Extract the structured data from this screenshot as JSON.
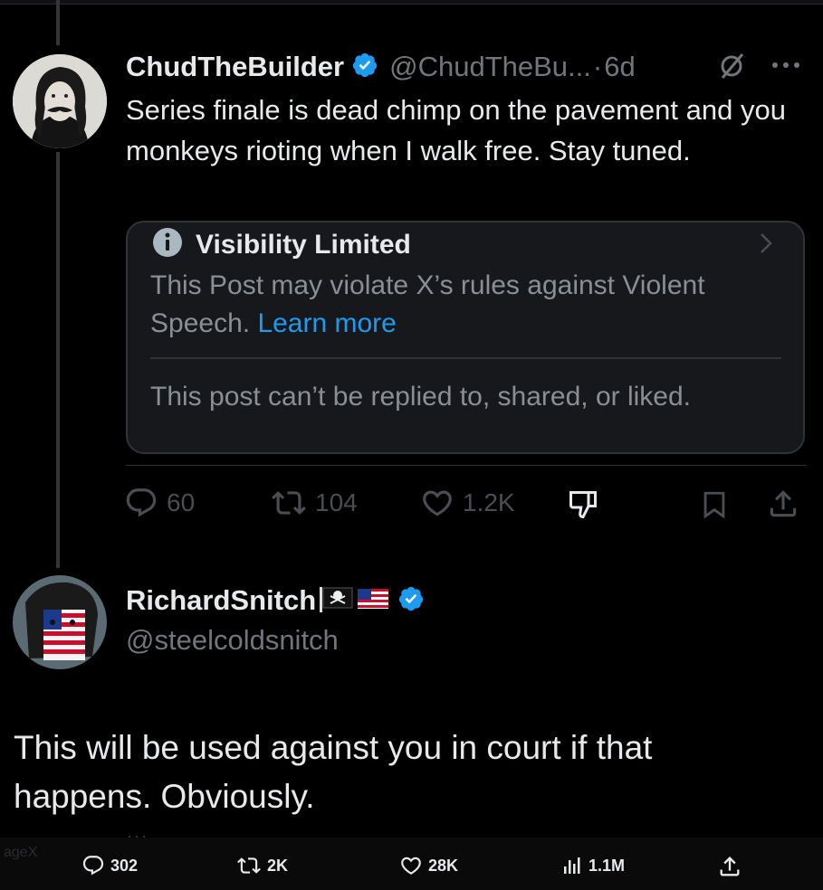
{
  "post": {
    "author_name": "ChudTheBuilder",
    "author_handle": "@ChudTheBu...",
    "separator": "·",
    "time": "6d",
    "text": "Series finale is dead chimp on the pavement and you monkeys rioting when I walk free. Stay tuned.",
    "notice": {
      "title": "Visibility Limited",
      "message": "This Post may violate X’s rules against Violent Speech.",
      "link": "Learn more",
      "restriction": "This post can’t be replied to, shared, or liked."
    },
    "stats": {
      "replies": "60",
      "reposts": "104",
      "likes": "1.2K"
    }
  },
  "reply": {
    "author_name": "RichardSnitch",
    "author_handle": "@steelcoldsnitch",
    "text": "This will be used against you in court if that happens. Obviously."
  },
  "bottom_bar": {
    "replies": "302",
    "reposts": "2K",
    "likes": "28K",
    "views": "1.1M"
  },
  "watermark": "ageX",
  "colors": {
    "background": "#000000",
    "verified": "#1d9bf0",
    "link": "#1d9bf0",
    "muted": "#71767b"
  }
}
